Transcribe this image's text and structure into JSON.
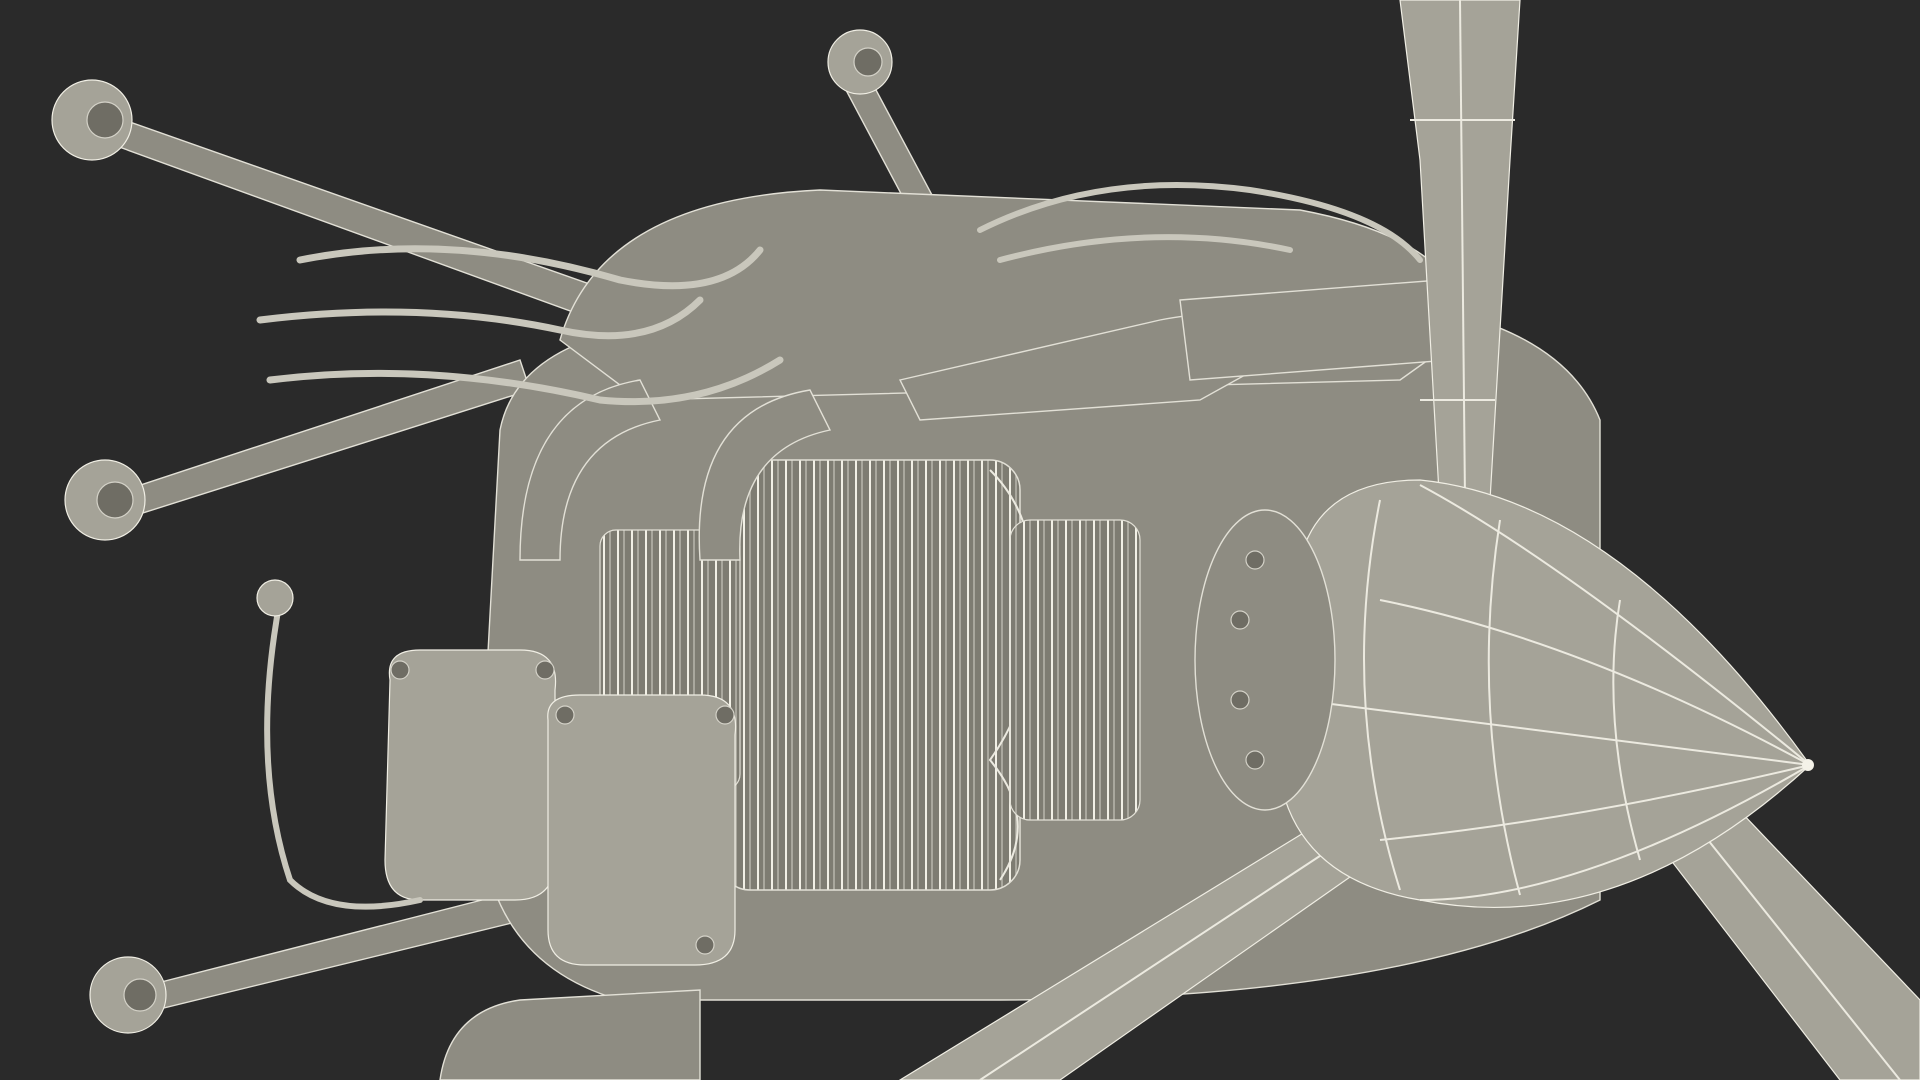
{
  "image": {
    "subject": "aircraft-engine-wireframe-render",
    "colors": {
      "background": "#2a2a2a",
      "model_fill": "#8e8c82",
      "wireframe": "#e2e0d6"
    }
  }
}
